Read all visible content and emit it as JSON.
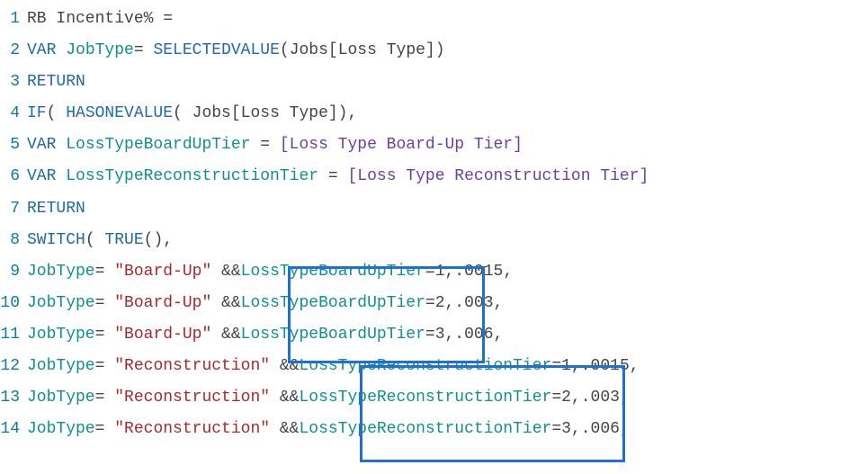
{
  "lines": {
    "l1": {
      "no": "1",
      "a": "RB Incentive% ="
    },
    "l2": {
      "no": "2",
      "a": "VAR",
      "b": "JobType",
      "c": "= ",
      "d": "SELECTEDVALUE",
      "e": "(Jobs[Loss Type])"
    },
    "l3": {
      "no": "3",
      "a": "RETURN"
    },
    "l4": {
      "no": "4",
      "a": "IF",
      "b": "( ",
      "c": "HASONEVALUE",
      "d": "( Jobs[Loss Type]),"
    },
    "l5": {
      "no": "5",
      "a": "VAR",
      "b": "LossTypeBoardUpTier",
      "c": " = ",
      "d": "[Loss Type Board-Up Tier]"
    },
    "l6": {
      "no": "6",
      "a": "VAR",
      "b": "LossTypeReconstructionTier",
      "c": " = ",
      "d": "[Loss Type Reconstruction Tier]"
    },
    "l7": {
      "no": "7",
      "a": "RETURN"
    },
    "l8": {
      "no": "8",
      "a": "SWITCH",
      "b": "( ",
      "c": "TRUE",
      "d": "(),"
    },
    "l9": {
      "no": "9",
      "a": "JobType",
      "b": "= ",
      "c": "\"Board-Up\"",
      "d": " &&",
      "e": "LossTypeBoardUpTier",
      "f": "=1,.0015,"
    },
    "l10": {
      "no": "10",
      "a": "JobType",
      "b": "= ",
      "c": "\"Board-Up\"",
      "d": " &&",
      "e": "LossTypeBoardUpTier",
      "f": "=2,.003,"
    },
    "l11": {
      "no": "11",
      "a": "JobType",
      "b": "= ",
      "c": "\"Board-Up\"",
      "d": " &&",
      "e": "LossTypeBoardUpTier",
      "f": "=3,.006,"
    },
    "l12": {
      "no": "12",
      "a": "JobType",
      "b": "= ",
      "c": "\"Reconstruction\"",
      "d": " &&",
      "e": "LossTypeReconstructionTier",
      "f": "=1,.0015,"
    },
    "l13": {
      "no": "13",
      "a": "JobType",
      "b": "= ",
      "c": "\"Reconstruction\"",
      "d": " &&",
      "e": "LossTypeReconstructionTier",
      "f": "=2,.003,"
    },
    "l14": {
      "no": "14",
      "a": "JobType",
      "b": "= ",
      "c": "\"Reconstruction\"",
      "d": " &&",
      "e": "LossTypeReconstructionTier",
      "f": "=3,.006,"
    }
  },
  "highlights": {
    "box1": {
      "top_line": 9,
      "bottom_line": 11,
      "text": "LossTypeBoardUpTier"
    },
    "box2": {
      "top_line": 12,
      "bottom_line": 14,
      "text": "LossTypeReconstructionTier"
    }
  }
}
